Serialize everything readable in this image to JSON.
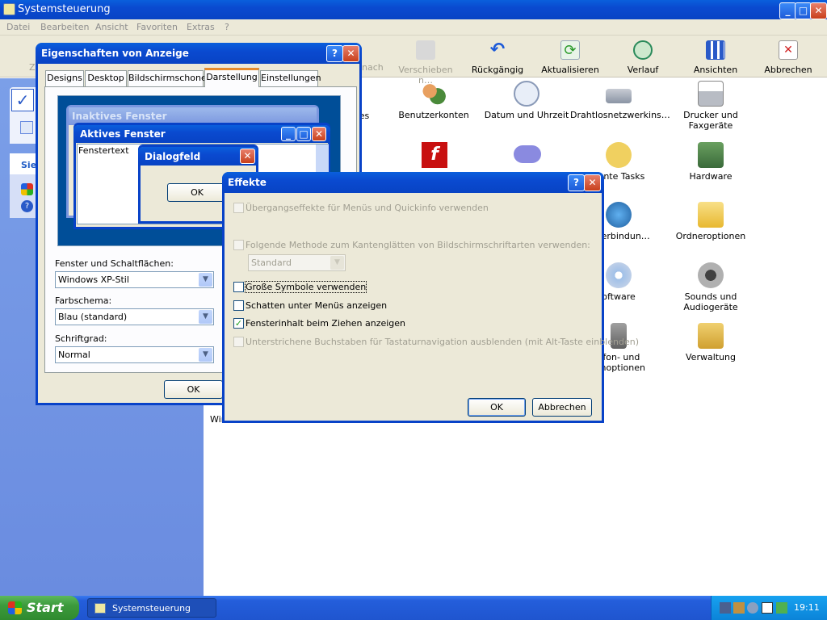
{
  "main_window": {
    "title": "Systemsteuerung",
    "menu": [
      "Datei",
      "Bearbeiten",
      "Ansicht",
      "Favoriten",
      "Extras",
      "?"
    ],
    "toolbar": {
      "partial_left": "Zu",
      "move_partial": "nach",
      "move": "Verschieben n…",
      "undo": "Rückgängig",
      "refresh": "Aktualisieren",
      "history": "Verlauf",
      "views": "Ansichten",
      "cancel": "Abbrechen"
    },
    "sidebar": {
      "partial_label": "Sie"
    },
    "items": [
      {
        "label": "odates"
      },
      {
        "label": "Benutzerkonten"
      },
      {
        "label": "Datum und Uhrzeit"
      },
      {
        "label": "Drahtlosnetzwerkins…"
      },
      {
        "label": "Drucker und Faxgeräte"
      },
      {
        "label": "nante Tasks"
      },
      {
        "label": "Hardware"
      },
      {
        "label": "rkverbindun…"
      },
      {
        "label": "Ordneroptionen"
      },
      {
        "label": "oftware"
      },
      {
        "label": "Sounds und Audiogeräte"
      },
      {
        "label": "efon- und emoptionen"
      },
      {
        "label": "Verwaltung"
      }
    ],
    "bottom_partial": "Wir"
  },
  "display_dialog": {
    "title": "Eigenschaften von Anzeige",
    "tabs": [
      "Designs",
      "Desktop",
      "Bildschirmschoner",
      "Darstellung",
      "Einstellungen"
    ],
    "active_tab": "Darstellung",
    "preview": {
      "inactive_title": "Inaktives Fenster",
      "active_title": "Aktives Fenster",
      "window_text": "Fenstertext",
      "dialog_title": "Dialogfeld",
      "ok": "OK"
    },
    "windows_buttons_label": "Fenster und Schaltflächen:",
    "windows_buttons_value": "Windows XP-Stil",
    "color_scheme_label": "Farbschema:",
    "color_scheme_value": "Blau (standard)",
    "font_size_label": "Schriftgrad:",
    "font_size_value": "Normal",
    "ok": "OK"
  },
  "effects_dialog": {
    "title": "Effekte",
    "options": [
      {
        "label": "Übergangseffekte für Menüs und Quickinfo verwenden",
        "checked": false,
        "enabled": false
      },
      {
        "label": "Folgende Methode zum Kantenglätten von Bildschirmschriftarten verwenden:",
        "checked": false,
        "enabled": false
      },
      {
        "label": "Große Symbole verwenden",
        "checked": false,
        "enabled": true
      },
      {
        "label": "Schatten unter Menüs anzeigen",
        "checked": false,
        "enabled": true
      },
      {
        "label": "Fensterinhalt beim Ziehen anzeigen",
        "checked": true,
        "enabled": true
      },
      {
        "label": "Unterstrichene Buchstaben für Tastaturnavigation ausblenden (mit Alt-Taste einblenden)",
        "checked": false,
        "enabled": false
      }
    ],
    "smoothing_value": "Standard",
    "ok": "OK",
    "cancel": "Abbrechen"
  },
  "taskbar": {
    "start": "Start",
    "task": "Systemsteuerung",
    "clock": "19:11"
  },
  "colors": {
    "xp_blue": "#0a4ad0",
    "dialog_bg": "#ece9d8",
    "taskbar": "#245edb",
    "start_green": "#3c9a3c"
  }
}
